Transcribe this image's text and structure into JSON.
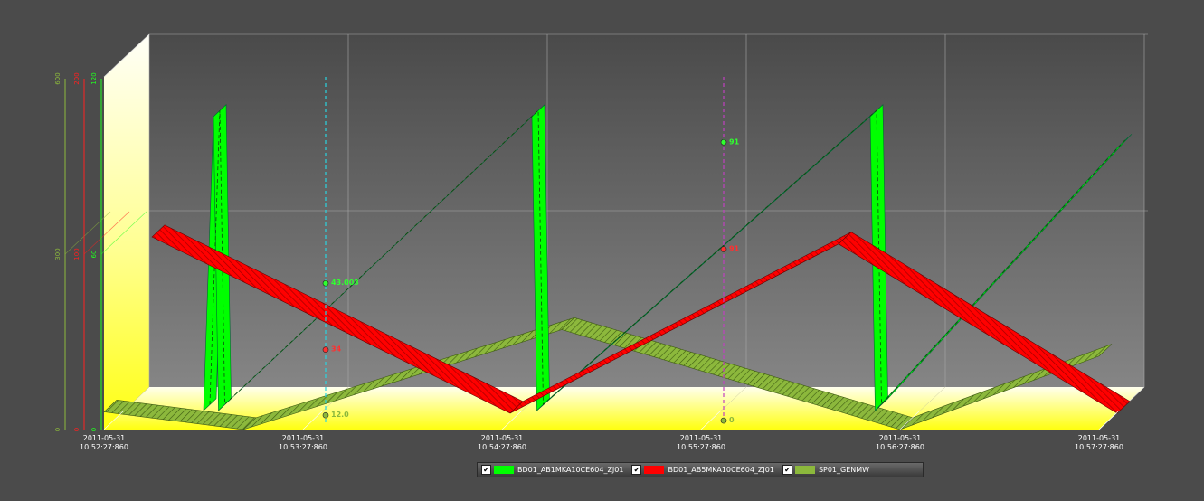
{
  "colors": {
    "background": "#4b4b4b",
    "series1": "#00ff00",
    "series2": "#ff0000",
    "series3": "#8cb83c",
    "cursor1": "#2ad4e0",
    "cursor2": "#c040c0",
    "floor": "#ffff20"
  },
  "chart_data": {
    "type": "line",
    "style": "3d-ribbon",
    "x": [
      "2011-05-31 10:52:27:860",
      "2011-05-31 10:53:27:860",
      "2011-05-31 10:54:27:860",
      "2011-05-31 10:55:27:860",
      "2011-05-31 10:56:27:860",
      "2011-05-31 10:57:27:860"
    ],
    "x_tick_labels": [
      {
        "date": "2011-05-31",
        "time": "10:52:27:860"
      },
      {
        "date": "2011-05-31",
        "time": "10:53:27:860"
      },
      {
        "date": "2011-05-31",
        "time": "10:54:27:860"
      },
      {
        "date": "2011-05-31",
        "time": "10:55:27:860"
      },
      {
        "date": "2011-05-31",
        "time": "10:56:27:860"
      },
      {
        "date": "2011-05-31",
        "time": "10:57:27:860"
      }
    ],
    "axes": [
      {
        "ticks": [
          "600",
          "300",
          "0"
        ],
        "ylim": [
          0,
          600
        ],
        "color": "#8cb83c"
      },
      {
        "ticks": [
          "200",
          "100",
          "0"
        ],
        "ylim": [
          0,
          200
        ],
        "color": "#ff2020"
      },
      {
        "ticks": [
          "120",
          "60",
          "0"
        ],
        "ylim": [
          0,
          120
        ],
        "color": "#20ff20"
      }
    ],
    "series": [
      {
        "name": "BD01_AB1MKA10CE604_ZJ01",
        "color": "#00ff00",
        "axis": 2,
        "points": [
          [
            0.08,
            0
          ],
          [
            0.09,
            100
          ],
          [
            0.095,
            0
          ],
          [
            0.41,
            100
          ],
          [
            0.415,
            0
          ],
          [
            0.75,
            100
          ],
          [
            0.755,
            0
          ],
          [
            1.0,
            90
          ]
        ]
      },
      {
        "name": "BD01_AB5MKA10CE604_ZJ01",
        "color": "#ff0000",
        "axis": 1,
        "points": [
          [
            0.03,
            100
          ],
          [
            0.39,
            0
          ],
          [
            0.72,
            96
          ],
          [
            1.0,
            0
          ]
        ]
      },
      {
        "name": "SP01_GENMW",
        "color": "#8cb83c",
        "axis": 0,
        "points": [
          [
            0.0,
            30
          ],
          [
            0.14,
            0
          ],
          [
            0.46,
            170
          ],
          [
            0.8,
            0
          ],
          [
            1.0,
            125
          ]
        ]
      }
    ],
    "cursors": [
      {
        "x": "2011-05-31 10:53:27:860",
        "color": "#2ad4e0",
        "readouts": [
          {
            "label": "34",
            "color": "#ff3030",
            "axis": 1,
            "value": 34
          },
          {
            "label": "43.003",
            "color": "#30ff30",
            "axis": 2,
            "value": 43.003
          },
          {
            "label": "12.0",
            "color": "#8cb83c",
            "axis": 0,
            "value": 12
          }
        ]
      },
      {
        "x": "2011-05-31 10:55:27:860",
        "color": "#c040c0",
        "readouts": [
          {
            "label": "91",
            "color": "#ff3030",
            "axis": 1,
            "value": 91
          },
          {
            "label": "91",
            "color": "#30ff30",
            "axis": 2,
            "value": 91
          },
          {
            "label": "0",
            "color": "#8cb83c",
            "axis": 0,
            "value": 3
          }
        ]
      }
    ],
    "grid": true,
    "legend": "bottom-center"
  },
  "legend": {
    "items": [
      {
        "label": "BD01_AB1MKA10CE604_ZJ01",
        "checked": "✔"
      },
      {
        "label": "BD01_AB5MKA10CE604_ZJ01",
        "checked": "✔"
      },
      {
        "label": "SP01_GENMW",
        "checked": "✔"
      }
    ]
  }
}
